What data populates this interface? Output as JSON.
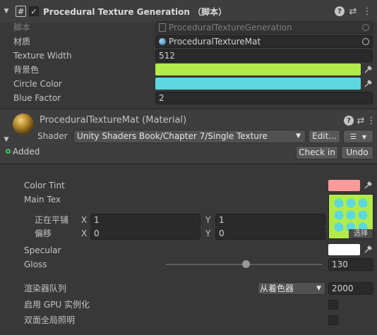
{
  "header": {
    "title": "Procedural Texture Generation （脚本）",
    "hash_glyph": "#",
    "check_glyph": "✓",
    "help_glyph": "?",
    "settings_glyph": "⇄",
    "menu_glyph": "⋮"
  },
  "script_component": {
    "rows": [
      {
        "label": "脚本",
        "value": "ProceduralTextureGeneration"
      },
      {
        "label": "材质",
        "value": "ProceduralTextureMat"
      },
      {
        "label": "Texture Width",
        "value": "512"
      },
      {
        "label": "背景色",
        "value": "",
        "color": "#b2eb4a"
      },
      {
        "label": "Circle Color",
        "value": "",
        "color": "#5dd8e0"
      },
      {
        "label": "Blue Factor",
        "value": "2"
      }
    ]
  },
  "material": {
    "name": "ProceduralTextureMat (Material)",
    "shader_label": "Shader",
    "shader_value": "Unity Shaders Book/Chapter 7/Single Texture",
    "edit_label": "Edit...",
    "list_glyph": "☰",
    "added_label": "Added",
    "check_in_label": "Check in",
    "undo_label": "Undo"
  },
  "properties": {
    "color_tint_label": "Color Tint",
    "color_tint_color": "#ff9a9a",
    "main_tex_label": "Main Tex",
    "tiling_label": "正在平铺",
    "offset_label": "偏移",
    "x_label": "X",
    "y_label": "Y",
    "tiling_x": "1",
    "tiling_y": "1",
    "offset_x": "0",
    "offset_y": "0",
    "select_label": "选择",
    "specular_label": "Specular",
    "specular_color": "#ffffff",
    "gloss_label": "Gloss",
    "gloss_value": "130",
    "gloss_fraction": 0.51,
    "render_queue_label": "渲染器队列",
    "render_queue_option": "从着色器",
    "render_queue_value": "2000",
    "gpu_instancing_label": "启用 GPU 实例化",
    "double_sided_gi_label": "双面全局照明"
  },
  "colors": {
    "texture_bg": "#b2eb4a",
    "texture_dot": "#5dd8e0"
  }
}
